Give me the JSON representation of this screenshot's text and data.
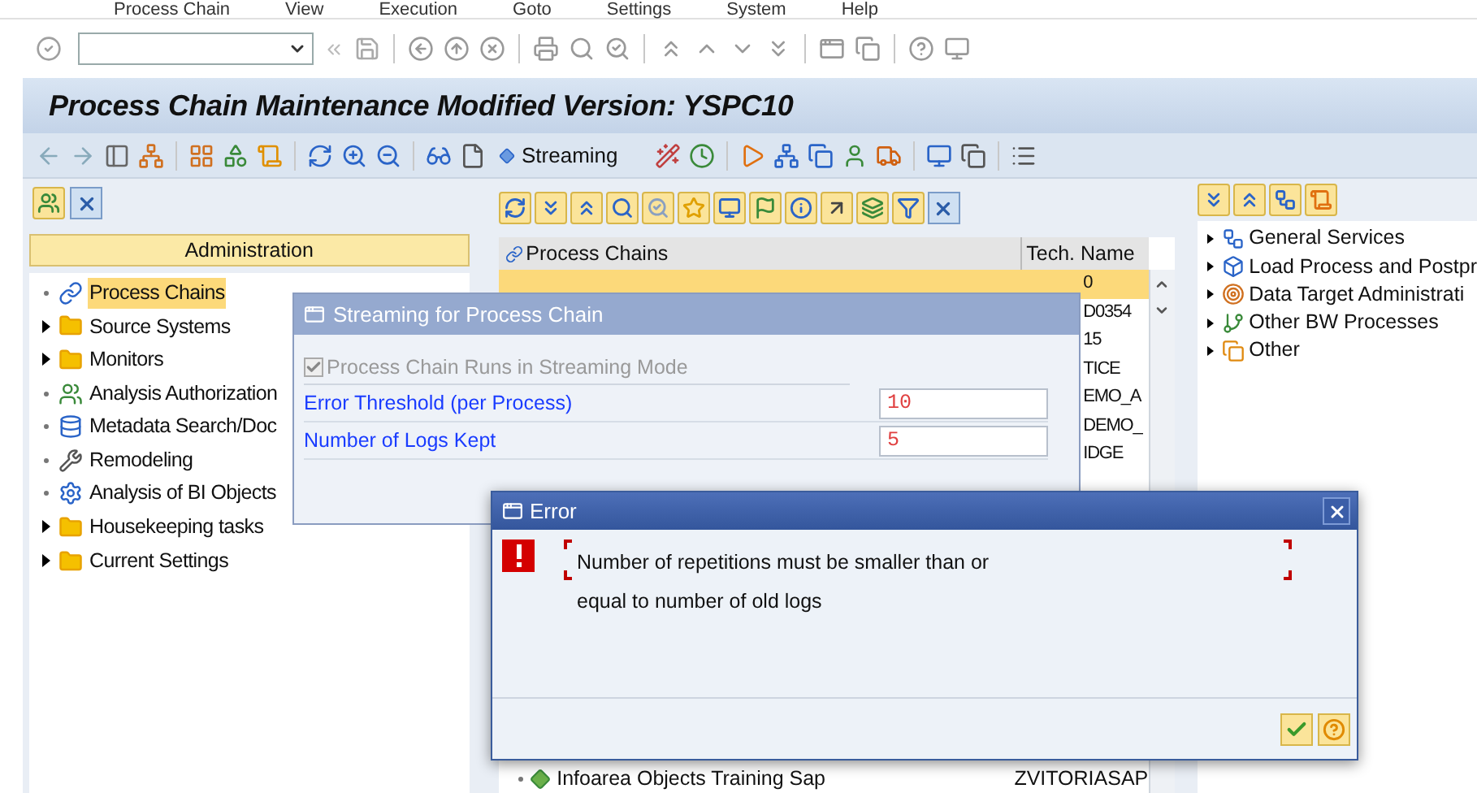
{
  "menu": [
    "Process Chain",
    "View",
    "Execution",
    "Goto",
    "Settings",
    "System",
    "Help"
  ],
  "title": "Process Chain Maintenance Modified Version: YSPC10",
  "app_toolbar": {
    "streaming_button": "Streaming"
  },
  "left_panel": {
    "header": "Administration",
    "tree": [
      {
        "label": "Process Chains",
        "kind": "leaf",
        "selected": true
      },
      {
        "label": "Source Systems",
        "kind": "folder",
        "expanded": false,
        "selected": false
      },
      {
        "label": "Monitors",
        "kind": "folder",
        "expanded": false,
        "selected": false
      },
      {
        "label": "Analysis Authorization",
        "kind": "leaf",
        "selected": false
      },
      {
        "label": "Metadata Search/Doc",
        "kind": "leaf",
        "selected": false
      },
      {
        "label": "Remodeling",
        "kind": "leaf",
        "selected": false
      },
      {
        "label": "Analysis of BI Objects",
        "kind": "leaf",
        "selected": false
      },
      {
        "label": "Housekeeping tasks",
        "kind": "folder",
        "expanded": false,
        "selected": false
      },
      {
        "label": "Current Settings",
        "kind": "folder",
        "expanded": false,
        "selected": false
      }
    ]
  },
  "middle_panel": {
    "columns": [
      "Process Chains",
      "Tech. Name"
    ],
    "rows_behind_dialog": [
      {
        "tech": "0",
        "selected": true
      },
      {
        "tech": "D0354",
        "selected": false
      },
      {
        "tech": "15",
        "selected": false
      },
      {
        "tech": "TICE",
        "selected": false
      },
      {
        "tech": "EMO_A",
        "selected": false
      },
      {
        "tech": "DEMO_",
        "selected": false
      },
      {
        "tech": "IDGE",
        "selected": false
      }
    ],
    "rows": [
      {
        "name": "Infoarea Objects Training Sap",
        "tech": "ZVITORIASAP",
        "selected": false
      }
    ]
  },
  "right_panel": {
    "tree": [
      {
        "label": "General Services",
        "expanded": false
      },
      {
        "label": "Load Process and Postpr",
        "expanded": false
      },
      {
        "label": "Data Target Administrati",
        "expanded": false
      },
      {
        "label": "Other BW Processes",
        "expanded": false
      },
      {
        "label": "Other",
        "expanded": false
      }
    ]
  },
  "streaming_dialog": {
    "title": "Streaming for Process Chain",
    "checkbox": {
      "label": "Process Chain Runs in Streaming Mode",
      "checked": true,
      "disabled": true
    },
    "fields": [
      {
        "label": "Error Threshold (per Process)",
        "value": "10"
      },
      {
        "label": "Number of Logs Kept",
        "value": "5"
      }
    ]
  },
  "error_dialog": {
    "title": "Error",
    "message_lines": [
      "Number of repetitions must be smaller than or",
      "equal to number of old logs"
    ]
  }
}
